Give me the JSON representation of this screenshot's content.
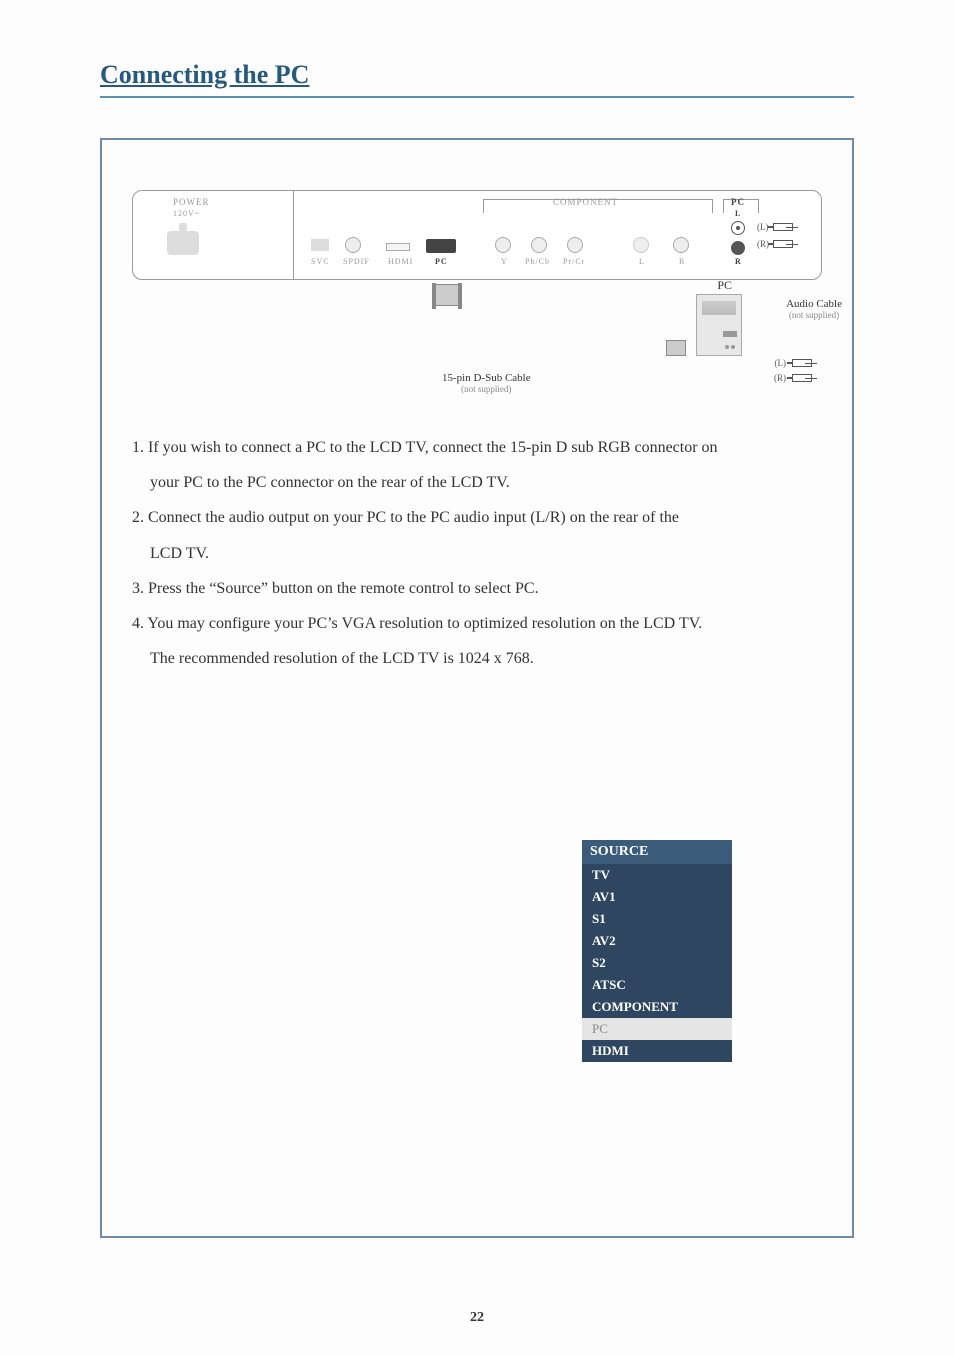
{
  "heading": "Connecting the PC",
  "diagram": {
    "power_label": "POWER",
    "voltage_label": "120V~",
    "svc_label": "SVC",
    "spdif_label": "SPDIF",
    "hdmi_label": "HDMI",
    "pc_label": "PC",
    "component_label": "COMPONENT",
    "y_label": "Y",
    "pbcb_label": "Pb/Cb",
    "prcr_label": "Pr/Cr",
    "l_label": "L",
    "r_label": "R",
    "pc_group_label": "PC",
    "pc_audio_l": "L",
    "pc_audio_r": "R",
    "plug_l": "(L)",
    "plug_r": "(R)",
    "pc_text": "PC",
    "audio_cable_label": "Audio Cable",
    "audio_cable_sub": "(not supplied)",
    "plug2_l": "(L)",
    "plug2_r": "(R)",
    "dsub_label": "15-pin D-Sub Cable",
    "dsub_sub": "(not supplied)"
  },
  "instructions": {
    "step1_line1": "1. If you wish to connect a PC to the LCD TV, connect the 15-pin D sub RGB connector on",
    "step1_line2": "your PC to the PC connector on the rear of the LCD TV.",
    "step2_line1": "2. Connect the audio output on your PC to the PC audio input (L/R) on the rear of the",
    "step2_line2": "LCD TV.",
    "step3": "3. Press the “Source” button on the remote control to select PC.",
    "step4_line1": "4. You may configure your PC’s VGA resolution to optimized resolution on the LCD TV.",
    "step4_line2": "The recommended resolution of the LCD TV is 1024 x 768."
  },
  "source_menu": {
    "title": "SOURCE",
    "items": [
      "TV",
      "AV1",
      "S1",
      "AV2",
      "S2",
      "ATSC",
      "COMPONENT",
      "PC",
      "HDMI"
    ],
    "selected": "PC"
  },
  "page_number": "22"
}
